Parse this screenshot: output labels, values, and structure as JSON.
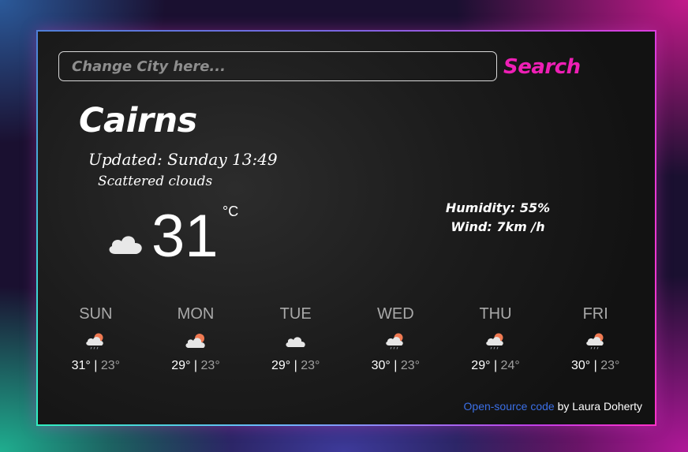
{
  "search": {
    "placeholder": "Change City here...",
    "button_label": "Search"
  },
  "current": {
    "city": "Cairns",
    "updated": "Updated: Sunday 13:49",
    "description": "Scattered clouds",
    "icon": "cloud-icon",
    "temperature": "31",
    "unit": "°C",
    "humidity": "Humidity: 55%",
    "wind": "Wind: 7km /h"
  },
  "forecast": [
    {
      "day": "SUN",
      "high": "31°",
      "low": "23°",
      "icon": "sun-cloud-rain-icon"
    },
    {
      "day": "MON",
      "high": "29°",
      "low": "23°",
      "icon": "sun-cloud-icon"
    },
    {
      "day": "TUE",
      "high": "29°",
      "low": "23°",
      "icon": "cloud-icon"
    },
    {
      "day": "WED",
      "high": "30°",
      "low": "23°",
      "icon": "sun-cloud-rain-icon"
    },
    {
      "day": "THU",
      "high": "29°",
      "low": "24°",
      "icon": "sun-cloud-rain-icon"
    },
    {
      "day": "FRI",
      "high": "30°",
      "low": "23°",
      "icon": "sun-cloud-rain-icon"
    }
  ],
  "footer": {
    "link_text": "Open-source code",
    "credit": " by Laura Doherty"
  },
  "colors": {
    "accent": "#ee1fb5",
    "link": "#3b6fe6",
    "card_background": "#1e1e1e"
  }
}
